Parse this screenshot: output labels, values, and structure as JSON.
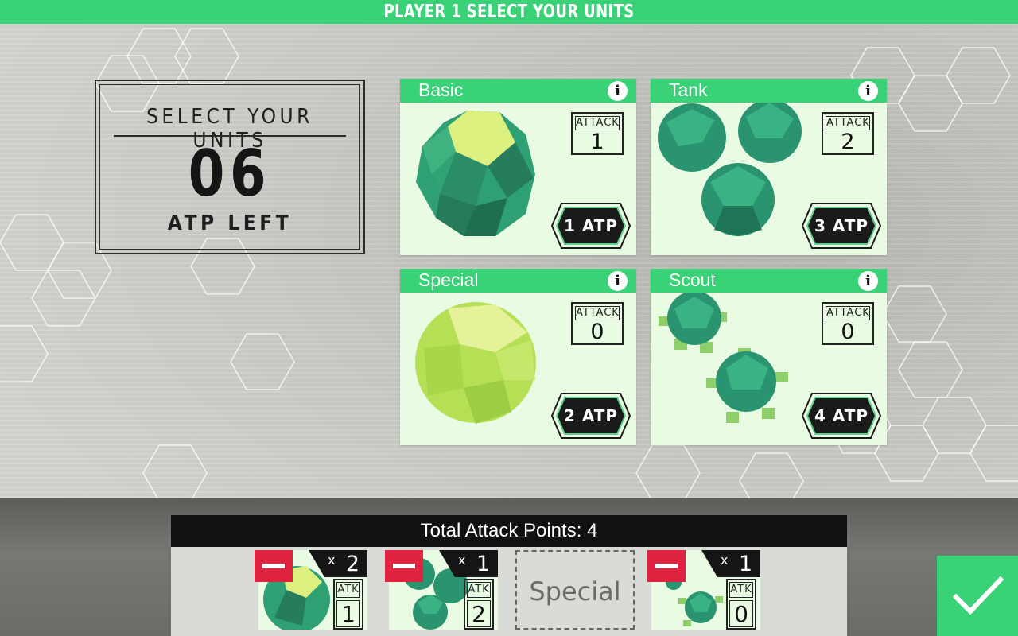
{
  "header": {
    "title": "PLAYER 1 SELECT YOUR UNITS"
  },
  "atp_panel": {
    "title": "SELECT YOUR UNITS",
    "count": "06",
    "subtitle": "ATP LEFT"
  },
  "units": [
    {
      "name": "Basic",
      "attack_label": "ATTACK",
      "attack": "1",
      "cost": "1 ATP",
      "info_icon": "info-icon",
      "color": "#2e9d72"
    },
    {
      "name": "Tank",
      "attack_label": "ATTACK",
      "attack": "2",
      "cost": "3 ATP",
      "info_icon": "info-icon",
      "color": "#2e9d72"
    },
    {
      "name": "Special",
      "attack_label": "ATTACK",
      "attack": "0",
      "cost": "2 ATP",
      "info_icon": "info-icon",
      "color": "#c7e86a"
    },
    {
      "name": "Scout",
      "attack_label": "ATTACK",
      "attack": "0",
      "cost": "4 ATP",
      "info_icon": "info-icon",
      "color": "#2e9d72"
    }
  ],
  "tray": {
    "total_label": "Total Attack Points: 4",
    "selected": [
      {
        "unit": "Basic",
        "count_prefix": "x",
        "count": "2",
        "atk_label": "ATK",
        "atk": "1"
      },
      {
        "unit": "Tank",
        "count_prefix": "x",
        "count": "1",
        "atk_label": "ATK",
        "atk": "2"
      },
      {
        "unit": "Scout",
        "count_prefix": "x",
        "count": "1",
        "atk_label": "ATK",
        "atk": "0"
      }
    ],
    "empty_slot_label": "Special"
  },
  "colors": {
    "accent": "#3ad276",
    "remove": "#df2340",
    "badge": "#1a1a1a"
  },
  "confirm_icon": "checkmark-icon"
}
